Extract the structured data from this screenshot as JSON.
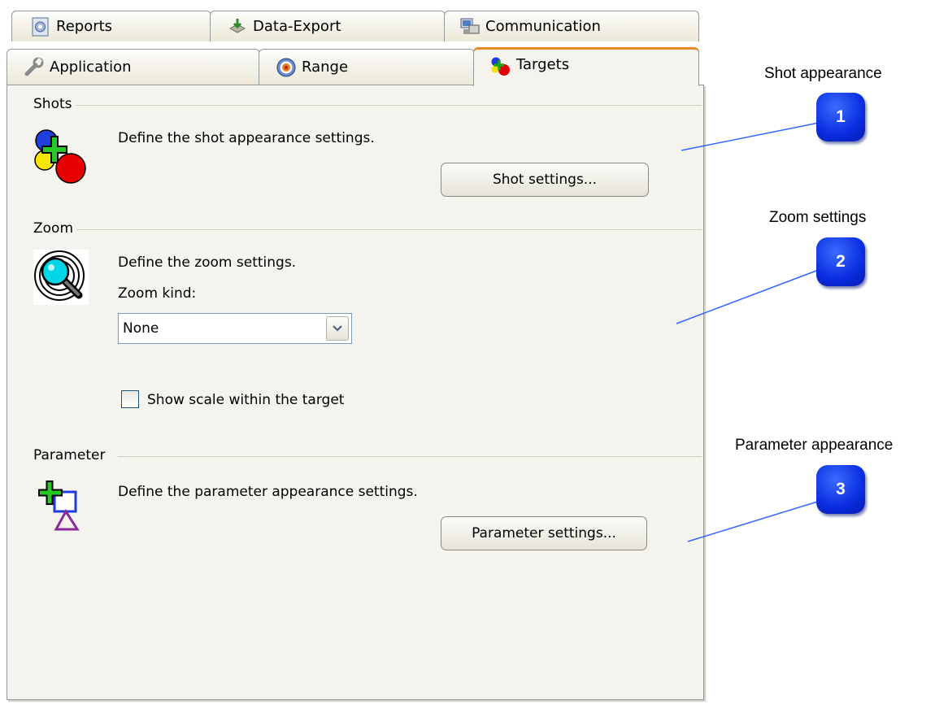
{
  "tabs": {
    "row1": [
      {
        "label": "Reports",
        "icon": "reports-icon"
      },
      {
        "label": "Data-Export",
        "icon": "data-export-icon"
      },
      {
        "label": "Communication",
        "icon": "communication-icon"
      }
    ],
    "row2": [
      {
        "label": "Application",
        "icon": "wrench-icon"
      },
      {
        "label": "Range",
        "icon": "range-target-icon"
      },
      {
        "label": "Targets",
        "icon": "targets-icon",
        "active": true
      }
    ]
  },
  "shots": {
    "group_label": "Shots",
    "description": "Define the shot appearance settings.",
    "button_label": "Shot settings...",
    "icon": "shots-icon"
  },
  "zoom": {
    "group_label": "Zoom",
    "description": "Define the zoom settings.",
    "kind_label": "Zoom kind:",
    "kind_value": "None",
    "show_scale_label": "Show scale within the target",
    "show_scale_checked": false,
    "icon": "zoom-magnifier-icon"
  },
  "parameter": {
    "group_label": "Parameter",
    "description": "Define the parameter appearance settings.",
    "button_label": "Parameter settings...",
    "icon": "parameter-icon"
  },
  "annotations": [
    {
      "label": "Shot appearance",
      "number": "1"
    },
    {
      "label": "Zoom settings",
      "number": "2"
    },
    {
      "label": "Parameter appearance",
      "number": "3"
    }
  ],
  "colors": {
    "badge": "#0a2de0",
    "active_tab_accent": "#e68b2c",
    "panel_bg": "#f4f3ee",
    "callout_line": "#3366ff"
  }
}
